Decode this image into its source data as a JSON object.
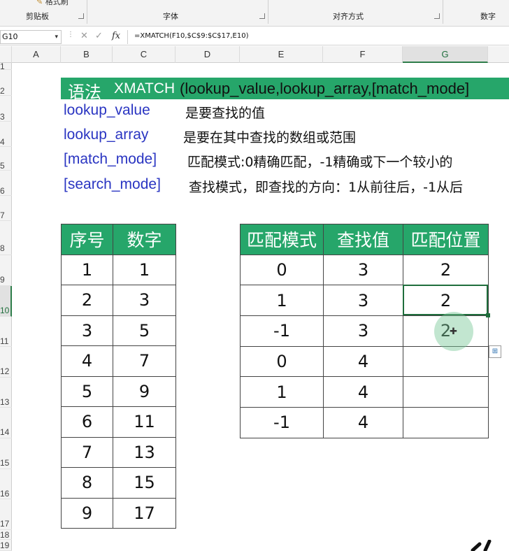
{
  "ribbon": {
    "groups": [
      {
        "label": "剪贴板"
      },
      {
        "label": "字体"
      },
      {
        "label": "对齐方式"
      },
      {
        "label": "数字"
      }
    ],
    "format_painter_label": "格式刷"
  },
  "formula_bar": {
    "name_box": "G10",
    "fx_label": "fx",
    "formula": "=XMATCH(F10,$C$9:$C$17,E10)"
  },
  "columns": [
    "A",
    "B",
    "C",
    "D",
    "E",
    "F",
    "G"
  ],
  "rows": [
    "1",
    "2",
    "3",
    "4",
    "5",
    "6",
    "7",
    "8",
    "9",
    "10",
    "11",
    "12",
    "13",
    "14",
    "15",
    "16",
    "17",
    "18",
    "19"
  ],
  "selected": {
    "column": "G",
    "row": "10"
  },
  "syntax": {
    "title_label": "语法",
    "function_name": "XMATCH",
    "signature": "(lookup_value,lookup_array,[match_mode]",
    "params": [
      {
        "name": "lookup_value",
        "desc": "是要查找的值"
      },
      {
        "name": "lookup_array",
        "desc": "是要在其中查找的数组或范围"
      },
      {
        "name": "[match_mode]",
        "desc": "匹配模式:0精确匹配，-1精确或下一个较小的"
      },
      {
        "name": "[search_mode]",
        "desc": "查找模式，即查找的方向：1从前往后，-1从后"
      }
    ]
  },
  "table_numbers": {
    "headers": [
      "序号",
      "数字"
    ],
    "rows": [
      [
        "1",
        "1"
      ],
      [
        "2",
        "3"
      ],
      [
        "3",
        "5"
      ],
      [
        "4",
        "7"
      ],
      [
        "5",
        "9"
      ],
      [
        "6",
        "11"
      ],
      [
        "7",
        "13"
      ],
      [
        "8",
        "15"
      ],
      [
        "9",
        "17"
      ]
    ]
  },
  "table_match": {
    "headers": [
      "匹配模式",
      "查找值",
      "匹配位置"
    ],
    "rows": [
      [
        "0",
        "3",
        "2"
      ],
      [
        "1",
        "3",
        "2"
      ],
      [
        "-1",
        "3",
        "2"
      ],
      [
        "0",
        "4",
        ""
      ],
      [
        "1",
        "4",
        ""
      ],
      [
        "-1",
        "4",
        ""
      ]
    ]
  },
  "colors": {
    "accent_green": "#26a66a",
    "param_blue": "#2a35c2",
    "selection_green": "#1f6e3c"
  }
}
